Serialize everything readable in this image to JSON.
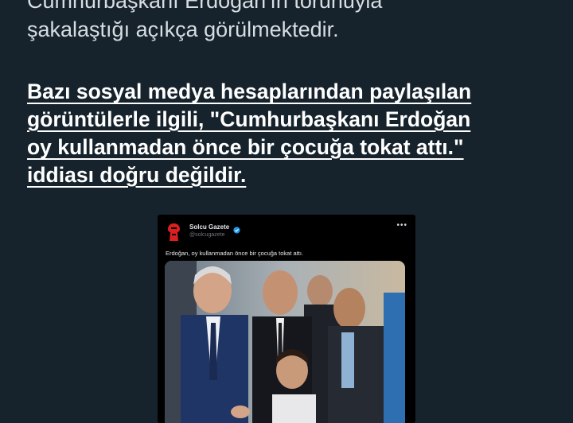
{
  "article": {
    "intro_lines": [
      "Cumhurbaşkanı Erdoğan'ın torunuyla",
      "şakalaştığı açıkça görülmektedir."
    ],
    "claim_lines": [
      "Bazı sosyal medya hesaplarından paylaşılan",
      "görüntülerle ilgili, \"Cumhurbaşkanı Erdoğan",
      "oy kullanmadan önce bir çocuğa tokat attı.\"",
      "iddiası doğru değildir."
    ]
  },
  "embedded_post": {
    "account_name": "Solcu Gazete",
    "handle": "@solcugazete",
    "more_icon": "ellipsis-icon",
    "verified_icon": "verified-badge-icon",
    "text": "Erdoğan, oy kullanmadan önce bir çocuğa tokat attı.",
    "image": "photo of Erdoğan smiling at a boy among bodyguards"
  },
  "colors": {
    "page_background": "#16232c",
    "claim_text": "#ffffff",
    "intro_text": "#d7dde1",
    "embed_background": "#000000",
    "brand_red": "#d91f1f",
    "verified_blue": "#1d9bf0"
  }
}
